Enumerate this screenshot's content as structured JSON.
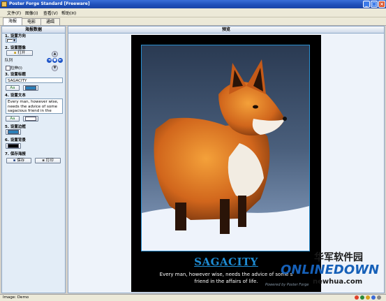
{
  "window": {
    "title": "Poster Forge Standard [Freeware]"
  },
  "menu": [
    "文件(F)",
    "图像(I)",
    "查看(V)",
    "帮助(H)"
  ],
  "tabs": [
    "海报",
    "电影",
    "通缉"
  ],
  "left_panel": {
    "header": "海报数据",
    "step1": "1. 设置方向",
    "step2": "2. 设置图像",
    "open_label": "打开",
    "align_label": "队列",
    "stretch_label": "拉伸(I)",
    "step3": "3. 设置标题",
    "title_value": "SAGACITY",
    "step4": "4. 设置文本",
    "text_value": "Every man, however wise, needs the advice of some sagacious friend in the affairs of life.",
    "font_btn_label": "Aa",
    "step5": "5. 设置边框",
    "step6": "6. 设置背景",
    "step7": "7. 保存海报",
    "save_label": "保存",
    "print_label": "打印"
  },
  "preview": {
    "header": "预览",
    "poster_title": "SAGACITY",
    "poster_text_line1": "Every man, however wise, needs the advice of some s",
    "poster_text_line2": "friend in the affairs of life.",
    "powered_by": "Powered by Poster Forge"
  },
  "watermark": {
    "chinese": "华军软件园",
    "brand": "ONLINEDOWN",
    "url": "newhua.com"
  },
  "status": {
    "text": "Image: Demo"
  },
  "colors": {
    "accent_blue": "#1e8bd2",
    "border_swatch": "#2a7fb8",
    "bg_swatch": "#000000"
  }
}
